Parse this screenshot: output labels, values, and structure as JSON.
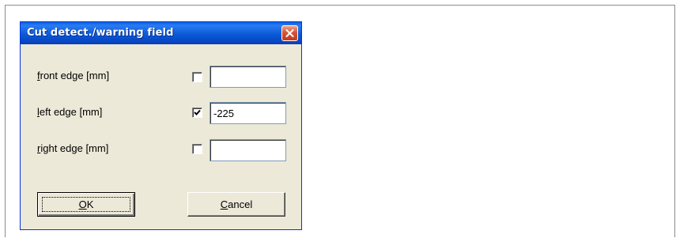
{
  "dialog": {
    "title": "Cut detect./warning field",
    "close_icon": "close-icon",
    "fields": [
      {
        "label_underlined": "f",
        "label_rest": "ront edge [mm]",
        "checked": false,
        "value": ""
      },
      {
        "label_underlined": "l",
        "label_rest": "eft edge [mm]",
        "checked": true,
        "value": "-225"
      },
      {
        "label_underlined": "r",
        "label_rest": "ight edge [mm]",
        "checked": false,
        "value": ""
      }
    ],
    "ok_button": {
      "mnemonic": "O",
      "rest": "K"
    },
    "cancel_button": {
      "mnemonic": "C",
      "rest": "ancel"
    }
  },
  "colors": {
    "title_bar": "#0a5ad6",
    "dialog_bg": "#ece9d8",
    "close_button": "#d5553a"
  }
}
